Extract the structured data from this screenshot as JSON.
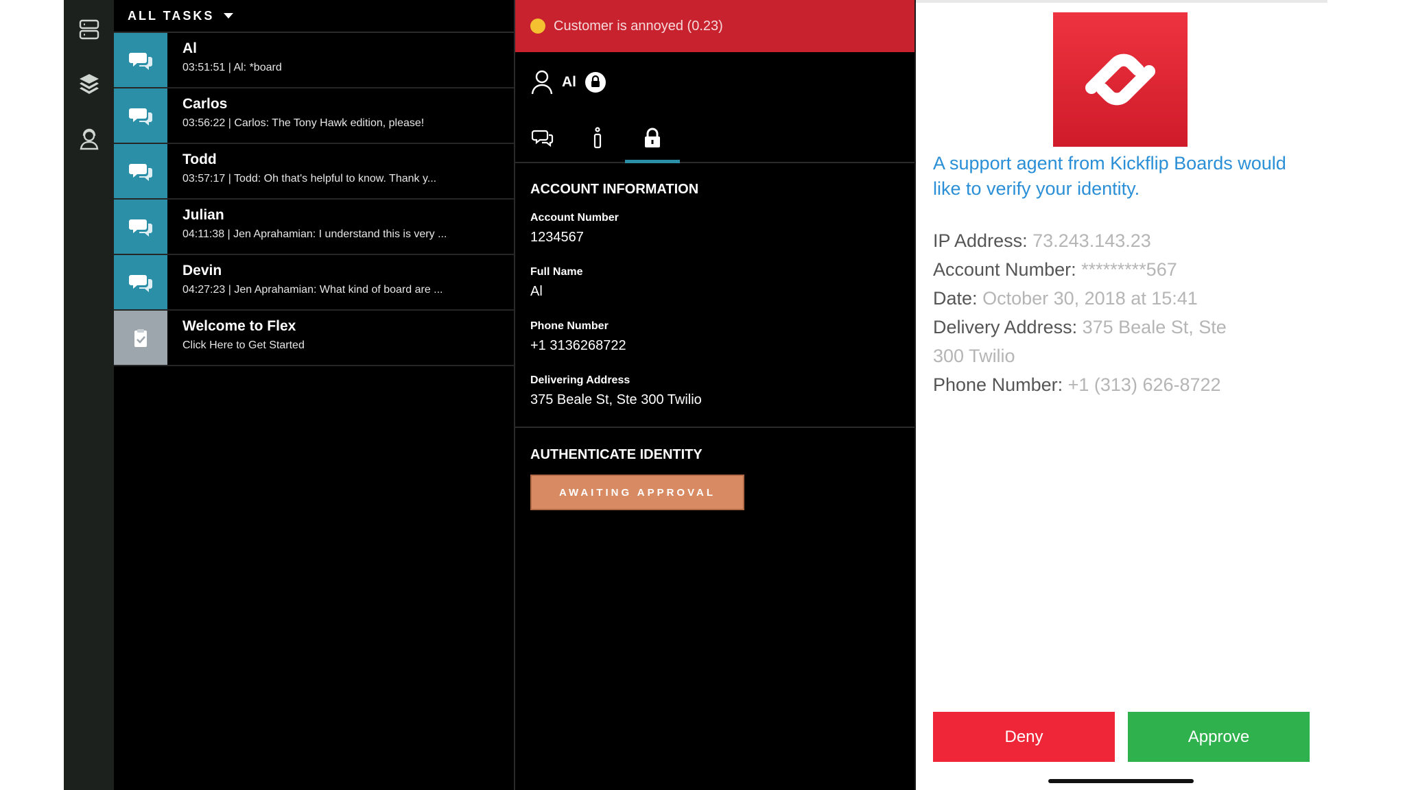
{
  "tasks_panel": {
    "header": "ALL TASKS",
    "tasks": [
      {
        "name": "Al",
        "preview": "03:51:51 | Al: *board"
      },
      {
        "name": "Carlos",
        "preview": "03:56:22 | Carlos: The Tony Hawk edition, please!"
      },
      {
        "name": "Todd",
        "preview": "03:57:17 | Todd: Oh that's helpful to know. Thank y..."
      },
      {
        "name": "Julian",
        "preview": "04:11:38 | Jen Aprahamian: I understand this is very ..."
      },
      {
        "name": "Devin",
        "preview": "04:27:23 | Jen Aprahamian: What kind of board are ..."
      },
      {
        "name": "Welcome to Flex",
        "preview": "Click Here to Get Started"
      }
    ]
  },
  "detail": {
    "banner": "Customer is annoyed (0.23)",
    "customer_name": "Al",
    "account_section": "ACCOUNT INFORMATION",
    "fields": [
      {
        "label": "Account Number",
        "value": "1234567"
      },
      {
        "label": "Full Name",
        "value": "Al"
      },
      {
        "label": "Phone Number",
        "value": "+1 3136268722"
      },
      {
        "label": "Delivering Address",
        "value": "375 Beale St, Ste 300 Twilio"
      }
    ],
    "auth_section": "AUTHENTICATE IDENTITY",
    "auth_button": "AWAITING APPROVAL"
  },
  "phone": {
    "message": "A support agent from Kickflip Boards would like to verify your identity.",
    "details": [
      {
        "key": "IP Address:",
        "value": "73.243.143.23"
      },
      {
        "key": "Account Number:",
        "value": "*********567"
      },
      {
        "key": "Date:",
        "value": "October 30, 2018 at 15:41"
      },
      {
        "key": "Delivery Address:",
        "value": "375 Beale St, Ste 300 Twilio"
      },
      {
        "key": "Phone Number:",
        "value": "+1 (313) 626-8722"
      }
    ],
    "deny_label": "Deny",
    "approve_label": "Approve"
  },
  "colors": {
    "banner_red": "#c8222f",
    "task_teal": "#2b8fa8",
    "await_orange": "#d88a62",
    "deny_red": "#ef2637",
    "approve_green": "#2fb24e",
    "link_blue": "#2a8fd6"
  }
}
